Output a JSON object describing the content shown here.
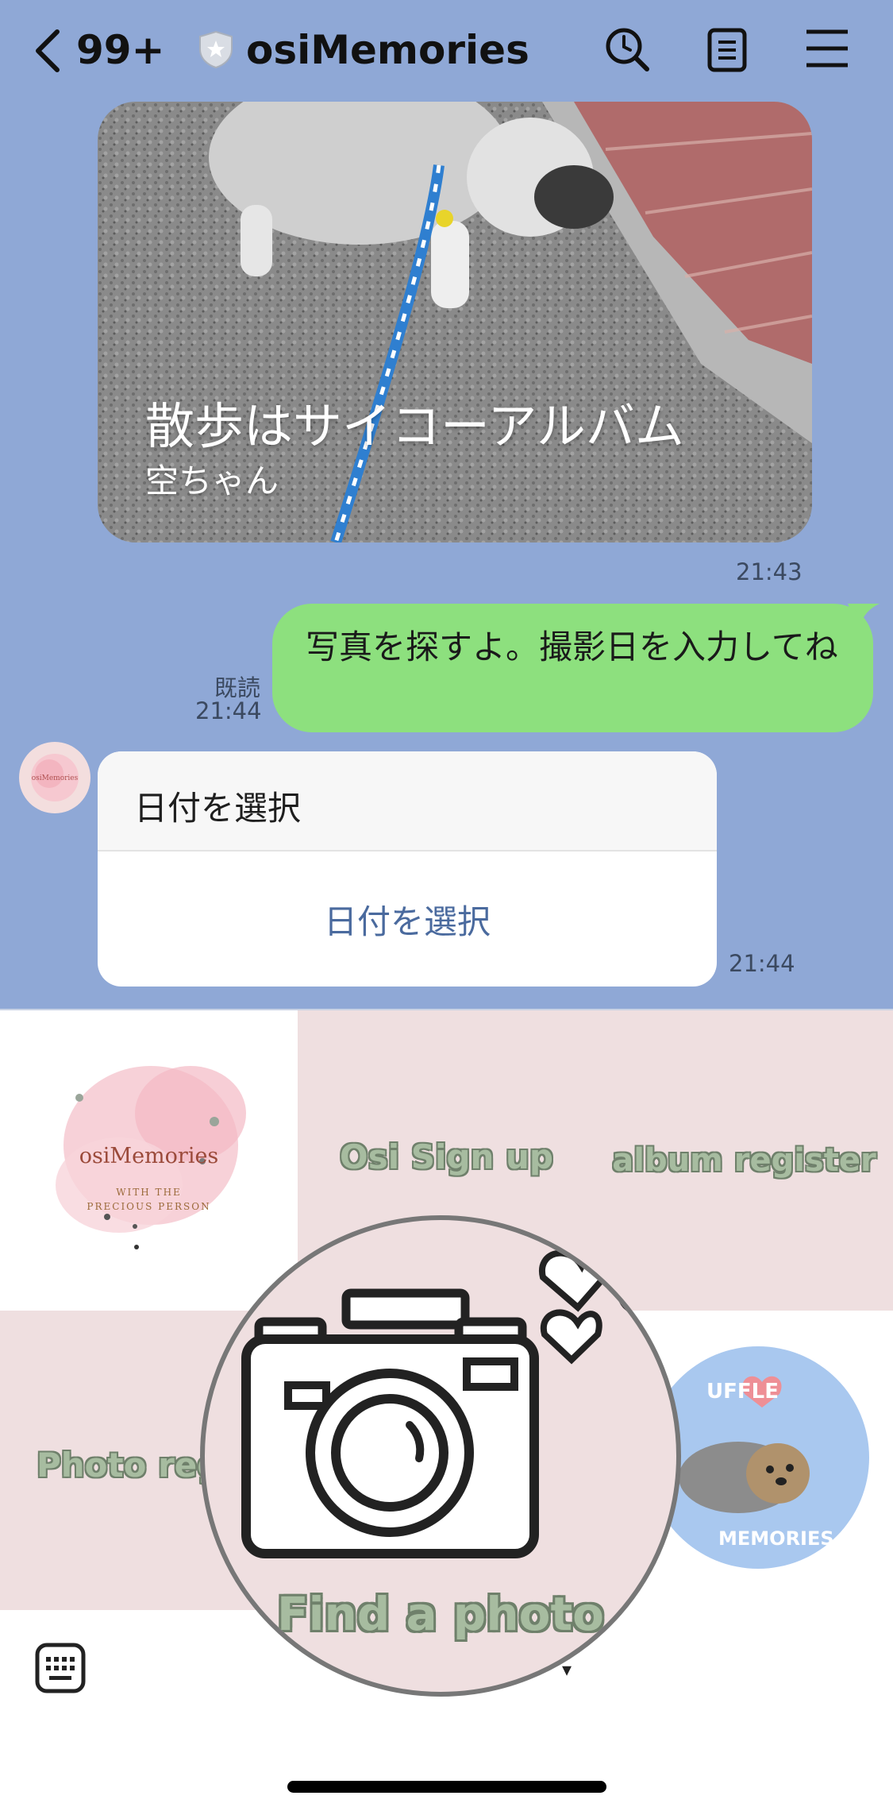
{
  "header": {
    "back_count": "99+",
    "chat_name": "osiMemories",
    "icons": [
      "chevron-left-icon",
      "shield-star-icon",
      "search-icon",
      "notes-icon",
      "menu-icon"
    ]
  },
  "messages": {
    "album": {
      "title": "散歩はサイコーアルバム",
      "subtitle": "空ちゃん",
      "time": "21:43"
    },
    "sent": {
      "text": "写真を探すよ。撮影日を入力してね",
      "read_label": "既読",
      "time": "21:44"
    },
    "date_picker": {
      "title": "日付を選択",
      "button_label": "日付を選択",
      "time": "21:44"
    },
    "avatar_text": "osiMemories"
  },
  "rich_menu": {
    "logo": {
      "name": "osiMemories",
      "tagline_line1": "WITH THE",
      "tagline_line2": "PRECIOUS PERSON"
    },
    "osi_signup": "Osi Sign up",
    "album_register": "album register",
    "photo_register": "Photo regis",
    "find_photo": "Find a photo",
    "badge_top": "UFFLE",
    "badge_bottom": "MEMORIES",
    "collapse_arrow": "▾"
  },
  "colors": {
    "chat_bg": "#8fa8d6",
    "sent_bubble": "#8de07e",
    "menu_pink": "#efdfe0",
    "menu_label": "#a7bca0",
    "link_blue": "#4a6a9e"
  }
}
